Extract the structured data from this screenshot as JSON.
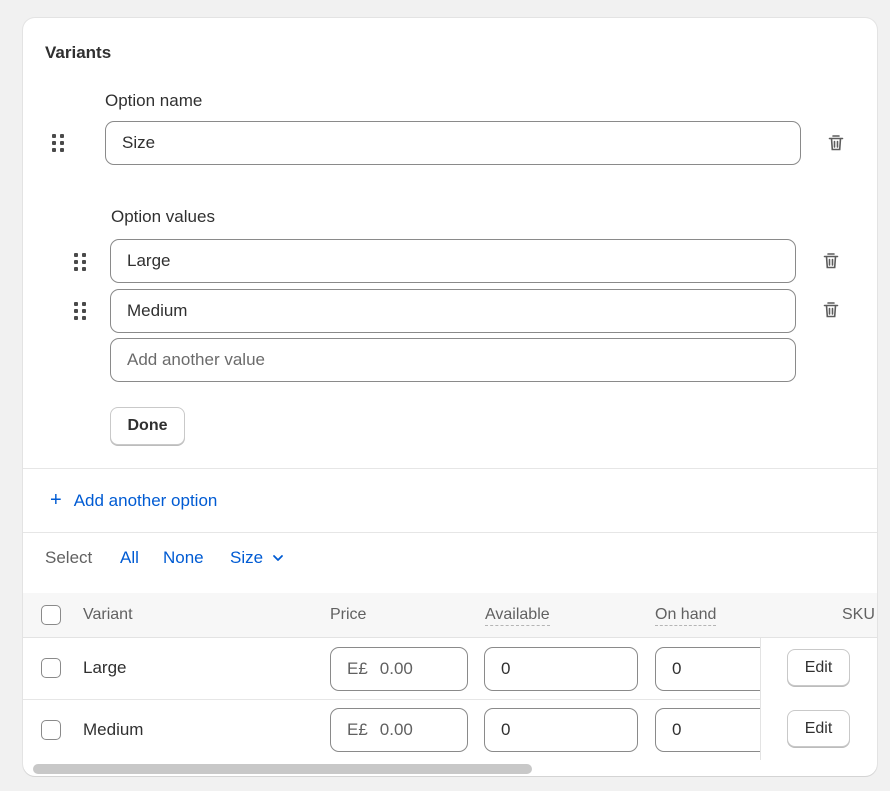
{
  "section_title": "Variants",
  "option_name": {
    "label": "Option name",
    "value": "Size"
  },
  "option_values": {
    "label": "Option values",
    "values": [
      "Large",
      "Medium"
    ],
    "placeholder": "Add another value"
  },
  "done_label": "Done",
  "add_option_label": "Add another option",
  "select": {
    "label": "Select",
    "all": "All",
    "none": "None",
    "size": "Size"
  },
  "table": {
    "headers": {
      "variant": "Variant",
      "price": "Price",
      "available": "Available",
      "on_hand": "On hand",
      "sku": "SKU"
    },
    "rows": [
      {
        "variant": "Large",
        "currency": "E£",
        "price": "0.00",
        "available": "0",
        "on_hand": "0",
        "edit": "Edit"
      },
      {
        "variant": "Medium",
        "currency": "E£",
        "price": "0.00",
        "available": "0",
        "on_hand": "0",
        "edit": "Edit"
      }
    ]
  },
  "colors": {
    "link": "#005bd3",
    "background": "#f1f1f1",
    "card": "#ffffff"
  }
}
